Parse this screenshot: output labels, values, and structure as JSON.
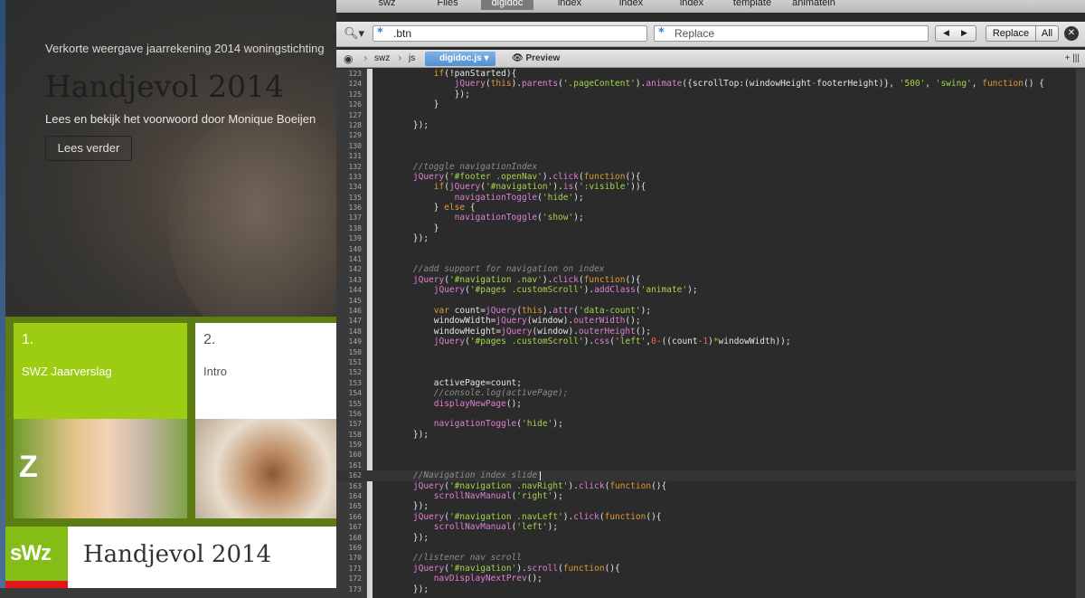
{
  "website": {
    "hero_subtitle": "Verkorte weergave jaarrekening 2014 woningstichting",
    "hero_title": "Handjevol 2014",
    "hero_lead": "Lees en bekijk het voorwoord door Monique Boeijen",
    "hero_button": "Lees verder",
    "cards": [
      {
        "number": "1.",
        "label": "SWZ Jaarverslag",
        "image_letter": "Z"
      },
      {
        "number": "2.",
        "label": "Intro"
      }
    ],
    "footer_logo": "sWz",
    "footer_title": "Handjevol 2014",
    "colors": {
      "green": "#9ccd12",
      "dark_green": "#5c7d13",
      "logo_green": "#85bd17",
      "logo_red": "#e4161b"
    }
  },
  "editor": {
    "tabs": [
      "swz",
      "Files",
      "digidoc",
      "index",
      "index",
      "index",
      "template",
      "animatein"
    ],
    "active_tab": 2,
    "find": {
      "search_icon": "magnifier-icon",
      "value": ".btn",
      "replace_placeholder": "Replace",
      "prev": "◀",
      "next": "▶",
      "replace_button": "Replace",
      "all_button": "All",
      "close": "✕"
    },
    "breadcrumbs": {
      "root": "swz",
      "folder": "js",
      "file": "digidoc.js",
      "preview": "Preview",
      "split": "+ |||"
    },
    "lines": [
      {
        "n": "123",
        "html": "        <span class='kw'>if</span>(!panStarted){"
      },
      {
        "n": "124",
        "html": "            <span class='mt'>jQuery</span>(<span class='kw'>this</span>).<span class='mt'>parents</span>(<span class='st'>'.pageContent'</span>).<span class='mt'>animate</span>({scrollTop:(windowHeight<span class='kw'>-</span>footerHeight)}, <span class='st'>'500'</span>, <span class='st'>'swing'</span>, <span class='kw'>function</span>() {"
      },
      {
        "n": "125",
        "html": "            });"
      },
      {
        "n": "126",
        "html": "        }"
      },
      {
        "n": "127",
        "html": ""
      },
      {
        "n": "128",
        "html": "    });"
      },
      {
        "n": "129",
        "html": ""
      },
      {
        "n": "130",
        "html": ""
      },
      {
        "n": "131",
        "html": ""
      },
      {
        "n": "132",
        "html": "    <span class='cm'>//toggle navigationIndex</span>"
      },
      {
        "n": "133",
        "html": "    <span class='mt'>jQuery</span>(<span class='st'>'#footer .openNav'</span>).<span class='mt'>click</span>(<span class='kw'>function</span>(){"
      },
      {
        "n": "134",
        "html": "        <span class='kw'>if</span>(<span class='mt'>jQuery</span>(<span class='st'>'#navigation'</span>).<span class='mt'>is</span>(<span class='st'>':visible'</span>)){"
      },
      {
        "n": "135",
        "html": "            <span class='mt'>navigationToggle</span>(<span class='st'>'hide'</span>);"
      },
      {
        "n": "136",
        "html": "        } <span class='kw'>else</span> {"
      },
      {
        "n": "137",
        "html": "            <span class='mt'>navigationToggle</span>(<span class='st'>'show'</span>);"
      },
      {
        "n": "138",
        "html": "        }"
      },
      {
        "n": "139",
        "html": "    });"
      },
      {
        "n": "140",
        "html": ""
      },
      {
        "n": "141",
        "html": ""
      },
      {
        "n": "142",
        "html": "    <span class='cm'>//add support for navigation on index</span>"
      },
      {
        "n": "143",
        "html": "    <span class='mt'>jQuery</span>(<span class='st'>'#navigation .nav'</span>).<span class='mt'>click</span>(<span class='kw'>function</span>(){"
      },
      {
        "n": "144",
        "html": "        <span class='mt'>jQuery</span>(<span class='st'>'#pages .customScroll'</span>).<span class='mt'>addClass</span>(<span class='st'>'animate'</span>);"
      },
      {
        "n": "145",
        "html": ""
      },
      {
        "n": "146",
        "html": "        <span class='kw'>var</span> count=<span class='mt'>jQuery</span>(<span class='kw'>this</span>).<span class='mt'>attr</span>(<span class='st'>'data-count'</span>);"
      },
      {
        "n": "147",
        "html": "        windowWidth=<span class='mt'>jQuery</span>(window).<span class='mt'>outerWidth</span>();"
      },
      {
        "n": "148",
        "html": "        windowHeight=<span class='mt'>jQuery</span>(window).<span class='mt'>outerHeight</span>();"
      },
      {
        "n": "149",
        "html": "        <span class='mt'>jQuery</span>(<span class='st'>'#pages .customScroll'</span>).<span class='mt'>css</span>(<span class='st'>'left'</span>,<span class='nm'>0</span><span class='kw'>-</span>((count<span class='kw'>-</span><span class='nm'>1</span>)<span class='kw'>*</span>windowWidth));"
      },
      {
        "n": "150",
        "html": ""
      },
      {
        "n": "151",
        "html": ""
      },
      {
        "n": "152",
        "html": ""
      },
      {
        "n": "153",
        "html": "        activePage=count;"
      },
      {
        "n": "154",
        "html": "        <span class='cm'>//console.log(activePage);</span>"
      },
      {
        "n": "155",
        "html": "        <span class='mt'>displayNewPage</span>();"
      },
      {
        "n": "156",
        "html": ""
      },
      {
        "n": "157",
        "html": "        <span class='mt'>navigationToggle</span>(<span class='st'>'hide'</span>);"
      },
      {
        "n": "158",
        "html": "    });"
      },
      {
        "n": "159",
        "html": ""
      },
      {
        "n": "160",
        "html": ""
      },
      {
        "n": "161",
        "html": ""
      },
      {
        "n": "162",
        "html": "    <span class='cm'>//Navigation index slide</span>",
        "current": true
      },
      {
        "n": "163",
        "html": "    <span class='mt'>jQuery</span>(<span class='st'>'#navigation .navRight'</span>).<span class='mt'>click</span>(<span class='kw'>function</span>(){"
      },
      {
        "n": "164",
        "html": "        <span class='mt'>scrollNavManual</span>(<span class='st'>'right'</span>);"
      },
      {
        "n": "165",
        "html": "    });"
      },
      {
        "n": "166",
        "html": "    <span class='mt'>jQuery</span>(<span class='st'>'#navigation .navLeft'</span>).<span class='mt'>click</span>(<span class='kw'>function</span>(){"
      },
      {
        "n": "167",
        "html": "        <span class='mt'>scrollNavManual</span>(<span class='st'>'left'</span>);"
      },
      {
        "n": "168",
        "html": "    });"
      },
      {
        "n": "169",
        "html": ""
      },
      {
        "n": "170",
        "html": "    <span class='cm'>//listener nav scroll</span>"
      },
      {
        "n": "171",
        "html": "    <span class='mt'>jQuery</span>(<span class='st'>'#navigation'</span>).<span class='mt'>scroll</span>(<span class='kw'>function</span>(){"
      },
      {
        "n": "172",
        "html": "        <span class='mt'>navDisplayNextPrev</span>();"
      },
      {
        "n": "173",
        "html": "    });"
      }
    ]
  }
}
